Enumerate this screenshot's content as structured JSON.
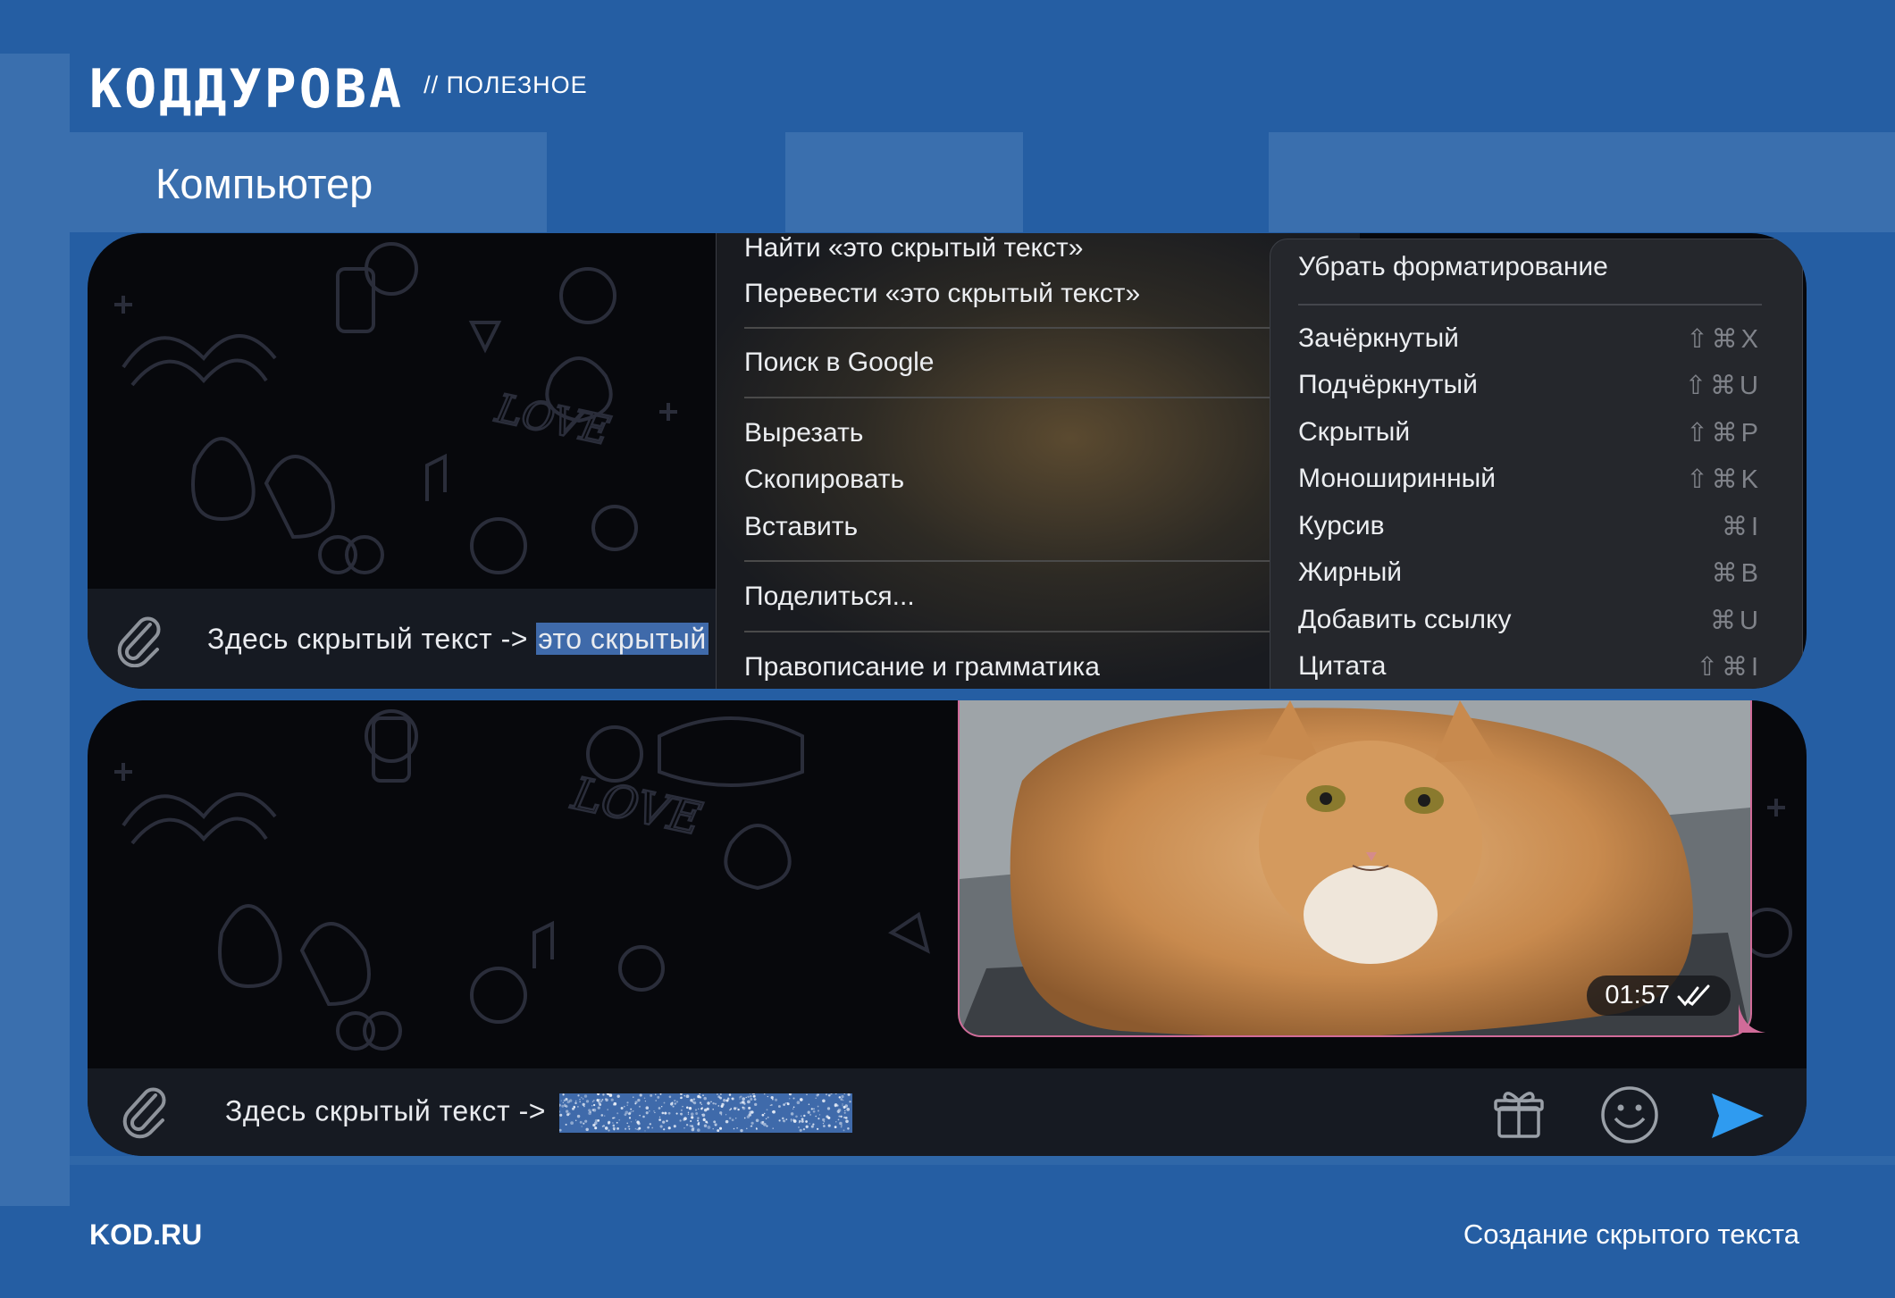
{
  "header": {
    "brand": "КОДДУРОВА",
    "section": "// ПОЛЕЗНОЕ",
    "title": "Компьютер"
  },
  "footer": {
    "site": "KOD.RU",
    "caption": "Создание скрытого текста"
  },
  "top_chat": {
    "composer_prefix": "Здесь скрытый текст ->",
    "composer_selection": "это скрытый",
    "context_menu": {
      "find": "Найти «это скрытый текст»",
      "translate": "Перевести «это скрытый текст»",
      "search_google": "Поиск в Google",
      "cut": "Вырезать",
      "copy": "Скопировать",
      "paste": "Вставить",
      "share": "Поделиться...",
      "spelling": "Правописание и грамматика",
      "spelling_arrow": "›"
    },
    "format_menu": {
      "clear": "Убрать форматирование",
      "items": [
        {
          "label": "Зачёркнутый",
          "shortcut": "⇧⌘X"
        },
        {
          "label": "Подчёркнутый",
          "shortcut": "⇧⌘U"
        },
        {
          "label": "Скрытый",
          "shortcut": "⇧⌘P"
        },
        {
          "label": "Моноширинный",
          "shortcut": "⇧⌘K"
        },
        {
          "label": "Курсив",
          "shortcut": "⌘I"
        },
        {
          "label": "Жирный",
          "shortcut": "⌘B"
        },
        {
          "label": "Добавить ссылку",
          "shortcut": "⌘U"
        },
        {
          "label": "Цитата",
          "shortcut": "⇧⌘I"
        }
      ]
    }
  },
  "bottom_chat": {
    "message_time": "01:57",
    "composer_prefix": "Здесь скрытый текст ->"
  },
  "colors": {
    "background": "#255ea3",
    "selection": "#3f6aaa",
    "send": "#2f9bf0",
    "bubble_border": "#d06b99"
  }
}
